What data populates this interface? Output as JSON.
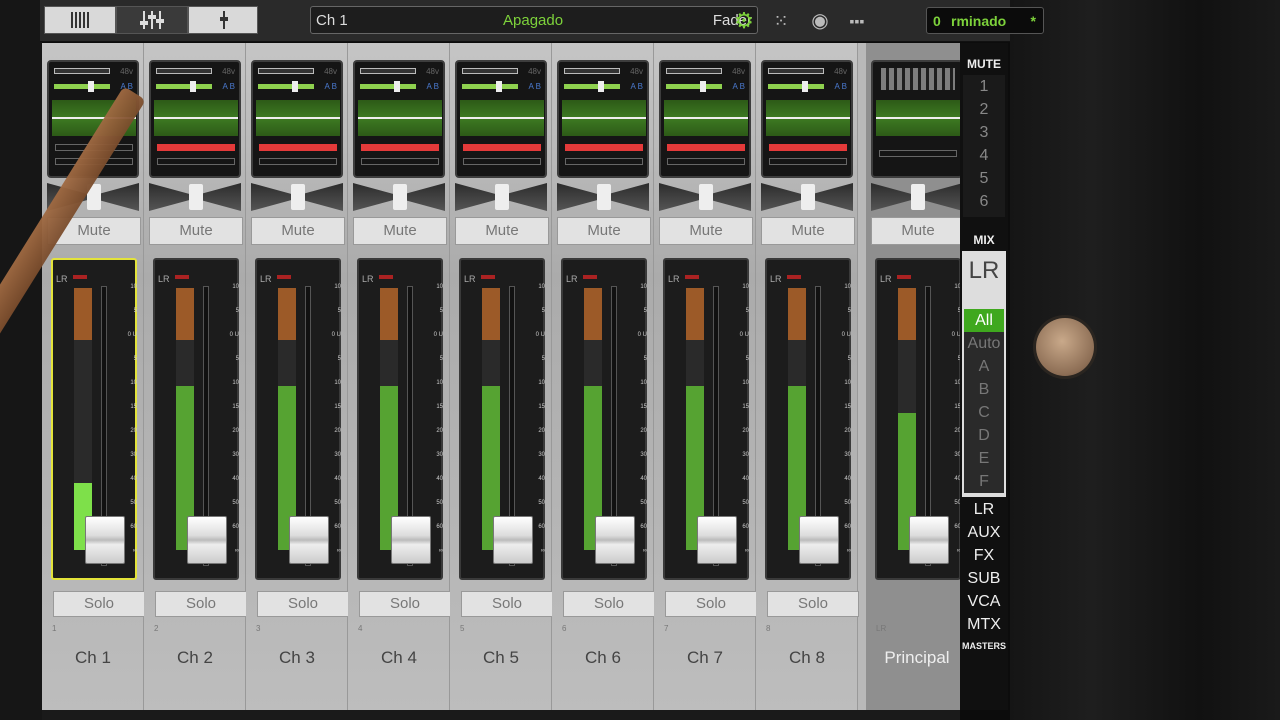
{
  "topbar": {
    "channel_name": "Ch 1",
    "status": "Apagado",
    "mode": "Fader",
    "snapshot_number": "0",
    "snapshot_name": "rminado",
    "snapshot_modified": "*"
  },
  "channels": [
    {
      "number": "1",
      "name": "Ch 1",
      "mute": "Mute",
      "solo": "Solo",
      "selected": true,
      "meter_level": 0.32
    },
    {
      "number": "2",
      "name": "Ch 2",
      "mute": "Mute",
      "solo": "Solo",
      "selected": false,
      "meter_level": 0.78
    },
    {
      "number": "3",
      "name": "Ch 3",
      "mute": "Mute",
      "solo": "Solo",
      "selected": false,
      "meter_level": 0.78
    },
    {
      "number": "4",
      "name": "Ch 4",
      "mute": "Mute",
      "solo": "Solo",
      "selected": false,
      "meter_level": 0.78
    },
    {
      "number": "5",
      "name": "Ch 5",
      "mute": "Mute",
      "solo": "Solo",
      "selected": false,
      "meter_level": 0.78
    },
    {
      "number": "6",
      "name": "Ch 6",
      "mute": "Mute",
      "solo": "Solo",
      "selected": false,
      "meter_level": 0.78
    },
    {
      "number": "7",
      "name": "Ch 7",
      "mute": "Mute",
      "solo": "Solo",
      "selected": false,
      "meter_level": 0.78
    },
    {
      "number": "8",
      "name": "Ch 8",
      "mute": "Mute",
      "solo": "Solo",
      "selected": false,
      "meter_level": 0.78
    }
  ],
  "main": {
    "tag": "LR",
    "name": "Principal",
    "mute": "Mute",
    "meter_level": 0.65
  },
  "right_panel": {
    "mute_label": "MUTE",
    "mute_groups": [
      "1",
      "2",
      "3",
      "4",
      "5",
      "6"
    ],
    "mix_label": "MIX",
    "mix_target": "LR",
    "view_filters": [
      "All",
      "Auto",
      "A",
      "B",
      "C",
      "D",
      "E",
      "F"
    ],
    "categories": [
      "LR",
      "AUX",
      "FX",
      "SUB",
      "VCA",
      "MTX"
    ],
    "masters_label": "MASTERS"
  },
  "scale": {
    "marks": [
      "10",
      "5",
      "0 U",
      "5",
      "10",
      "15",
      "20",
      "30",
      "40",
      "50",
      "60",
      "∞"
    ]
  },
  "colors": {
    "accent_green": "#56a332",
    "selection": "#e3e33a",
    "mute_red": "#e43a3a"
  }
}
